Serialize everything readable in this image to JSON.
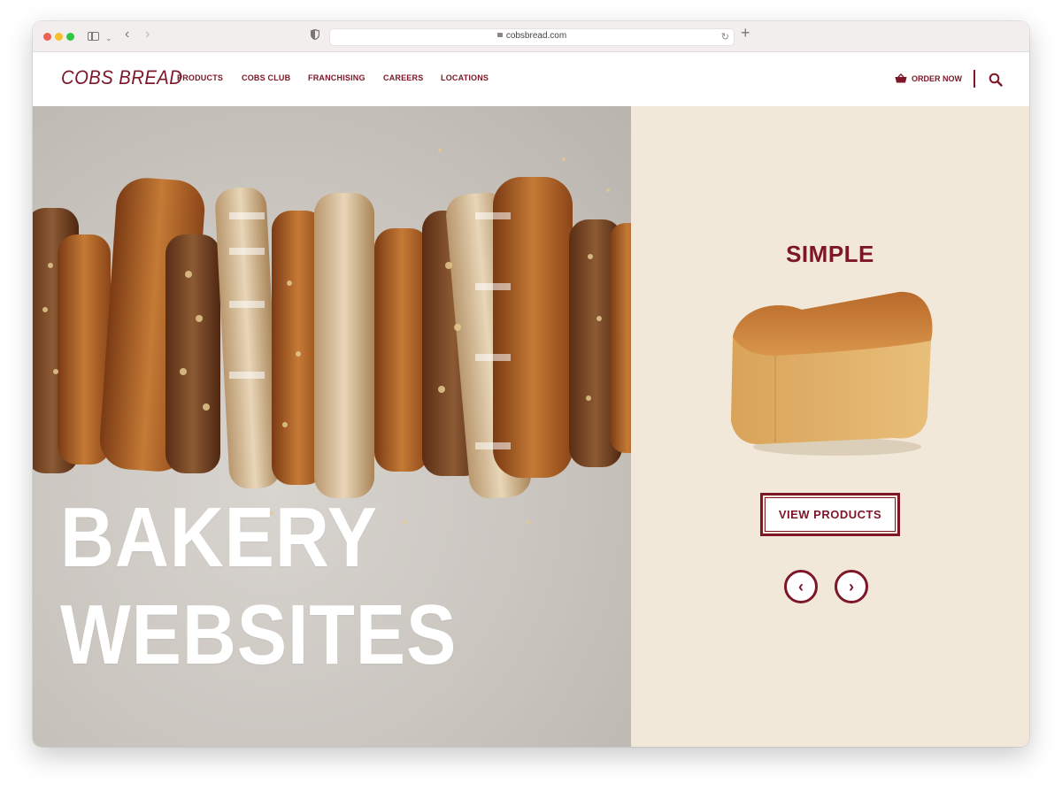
{
  "browser": {
    "url": "cobsbread.com"
  },
  "header": {
    "logo": "COBS BREAD",
    "nav": [
      {
        "label": "PRODUCTS"
      },
      {
        "label": "COBS CLUB"
      },
      {
        "label": "FRANCHISING"
      },
      {
        "label": "CAREERS"
      },
      {
        "label": "LOCATIONS"
      }
    ],
    "order_label": "ORDER NOW"
  },
  "hero": {
    "headline_line1": "BAKERY",
    "headline_line2": "WEBSITES"
  },
  "slide": {
    "title": "SIMPLE",
    "button_label": "VIEW PRODUCTS",
    "prev_label": "‹",
    "next_label": "›"
  },
  "colors": {
    "brand": "#7c1628",
    "panel": "#f1e8da"
  },
  "icons": [
    "sidebar-icon",
    "chevron-down-icon",
    "back-arrow-icon",
    "forward-arrow-icon",
    "shield-icon",
    "lock-icon",
    "reload-icon",
    "plus-icon",
    "basket-icon",
    "search-icon"
  ]
}
